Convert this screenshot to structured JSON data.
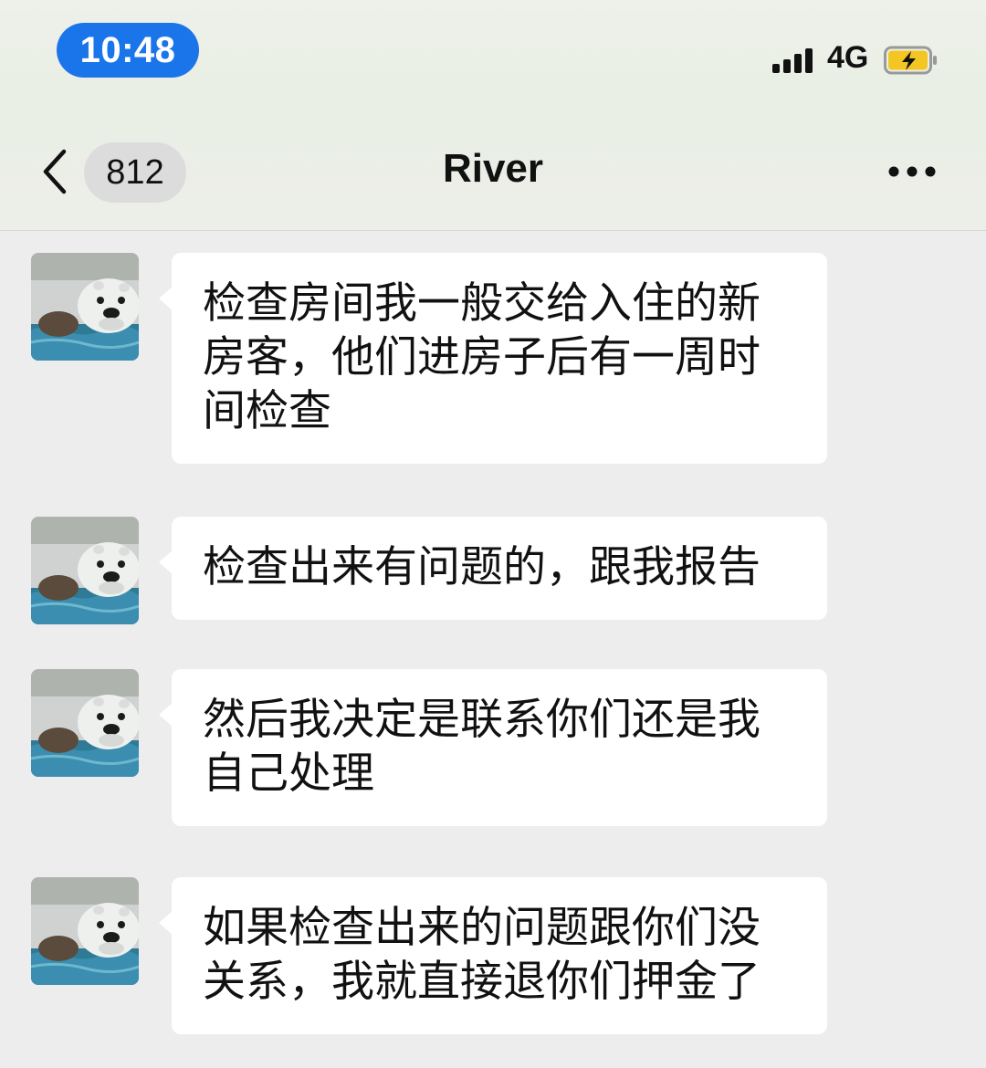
{
  "status_bar": {
    "time": "10:48",
    "network": "4G",
    "signal_icon": "signal-bars-icon",
    "battery_icon": "battery-charging-icon"
  },
  "nav": {
    "back_icon": "chevron-left-icon",
    "unread_count": "812",
    "title": "River",
    "more_icon": "more-dots-icon"
  },
  "colors": {
    "time_pill": "#1a75ea",
    "chat_background": "#ededed",
    "bubble": "#ffffff",
    "battery_charge": "#f3c623"
  },
  "messages": [
    {
      "sender": "River",
      "avatar_icon": "sea-otter-avatar",
      "text": "检查房间我一般交给入住的新房客，他们进房子后有一周时间检查"
    },
    {
      "sender": "River",
      "avatar_icon": "sea-otter-avatar",
      "text": "检查出来有问题的，跟我报告"
    },
    {
      "sender": "River",
      "avatar_icon": "sea-otter-avatar",
      "text": "然后我决定是联系你们还是我自己处理"
    },
    {
      "sender": "River",
      "avatar_icon": "sea-otter-avatar",
      "text": "如果检查出来的问题跟你们没关系，我就直接退你们押金了"
    }
  ]
}
